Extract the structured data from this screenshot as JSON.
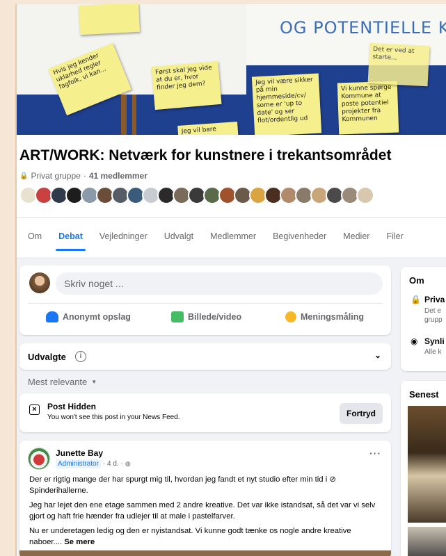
{
  "cover": {
    "title_text": "OG POTENTIELLE KU",
    "notes": [
      "Først skal jeg vide at du er, hvor finder jeg dem?",
      "Jeg vil være sikker på min hjemmeside/cv/ some er 'up to date' og ser flot/ordentlig ud",
      "Vi kunne spørge Kommune at poste potentiel projekter fra Kommunen",
      "Jeg vil bare prøve",
      "Hvis jeg kender uklarhed regler fagfolk, vi kan...",
      "Det er ved at starte..."
    ]
  },
  "group": {
    "title": "ART/WORK: Netværk for kunstnere i trekantsområdet",
    "privacy": "Privat gruppe",
    "separator": "·",
    "members": "41 medlemmer"
  },
  "tabs": [
    {
      "label": "Om",
      "active": false
    },
    {
      "label": "Debat",
      "active": true
    },
    {
      "label": "Vejledninger",
      "active": false
    },
    {
      "label": "Udvalgt",
      "active": false
    },
    {
      "label": "Medlemmer",
      "active": false
    },
    {
      "label": "Begivenheder",
      "active": false
    },
    {
      "label": "Medier",
      "active": false
    },
    {
      "label": "Filer",
      "active": false
    }
  ],
  "composer": {
    "placeholder": "Skriv noget ...",
    "actions": [
      {
        "label": "Anonymt opslag",
        "icon": "incognito-icon",
        "color": "#1877f2"
      },
      {
        "label": "Billede/video",
        "icon": "photo-icon",
        "color": "#45bd62"
      },
      {
        "label": "Meningsmåling",
        "icon": "poll-icon",
        "color": "#f7b928"
      }
    ]
  },
  "featured": {
    "label": "Udvalgte",
    "info": "i",
    "chevron": "⌄"
  },
  "sort": {
    "label": "Mest relevante",
    "caret": "▼"
  },
  "hidden_post": {
    "title": "Post Hidden",
    "subtitle": "You won't see this post in your News Feed.",
    "undo": "Fortryd",
    "icon": "×"
  },
  "post": {
    "author": "Junette Bay",
    "role": "Administrator",
    "time": "· 4 d. ·",
    "more": "···",
    "paragraphs": [
      "Der er rigtig mange der har spurgt mig til, hvordan jeg fandt et nyt studio efter min tid i ⊘ Spinderihallerne.",
      "Jeg har lejet den ene etage sammen med 2 andre kreative. Det var ikke istandsat, så det var vi selv gjort og haft frie hænder fra udlejer til at male i pastelfarver.",
      "Nu er underetagen ledig og den er nyistandsat. Vi kunne godt tænke os nogle andre kreative naboer...."
    ],
    "see_more": "Se mere"
  },
  "sidebar": {
    "about_title": "Om",
    "private_title": "Priva",
    "private_desc": "Det e grupp",
    "visible_title": "Synli",
    "visible_desc": "Alle k",
    "recent_title": "Senest"
  },
  "colors": {
    "accent": "#1877f2",
    "page_bg": "#f0f2f5"
  }
}
